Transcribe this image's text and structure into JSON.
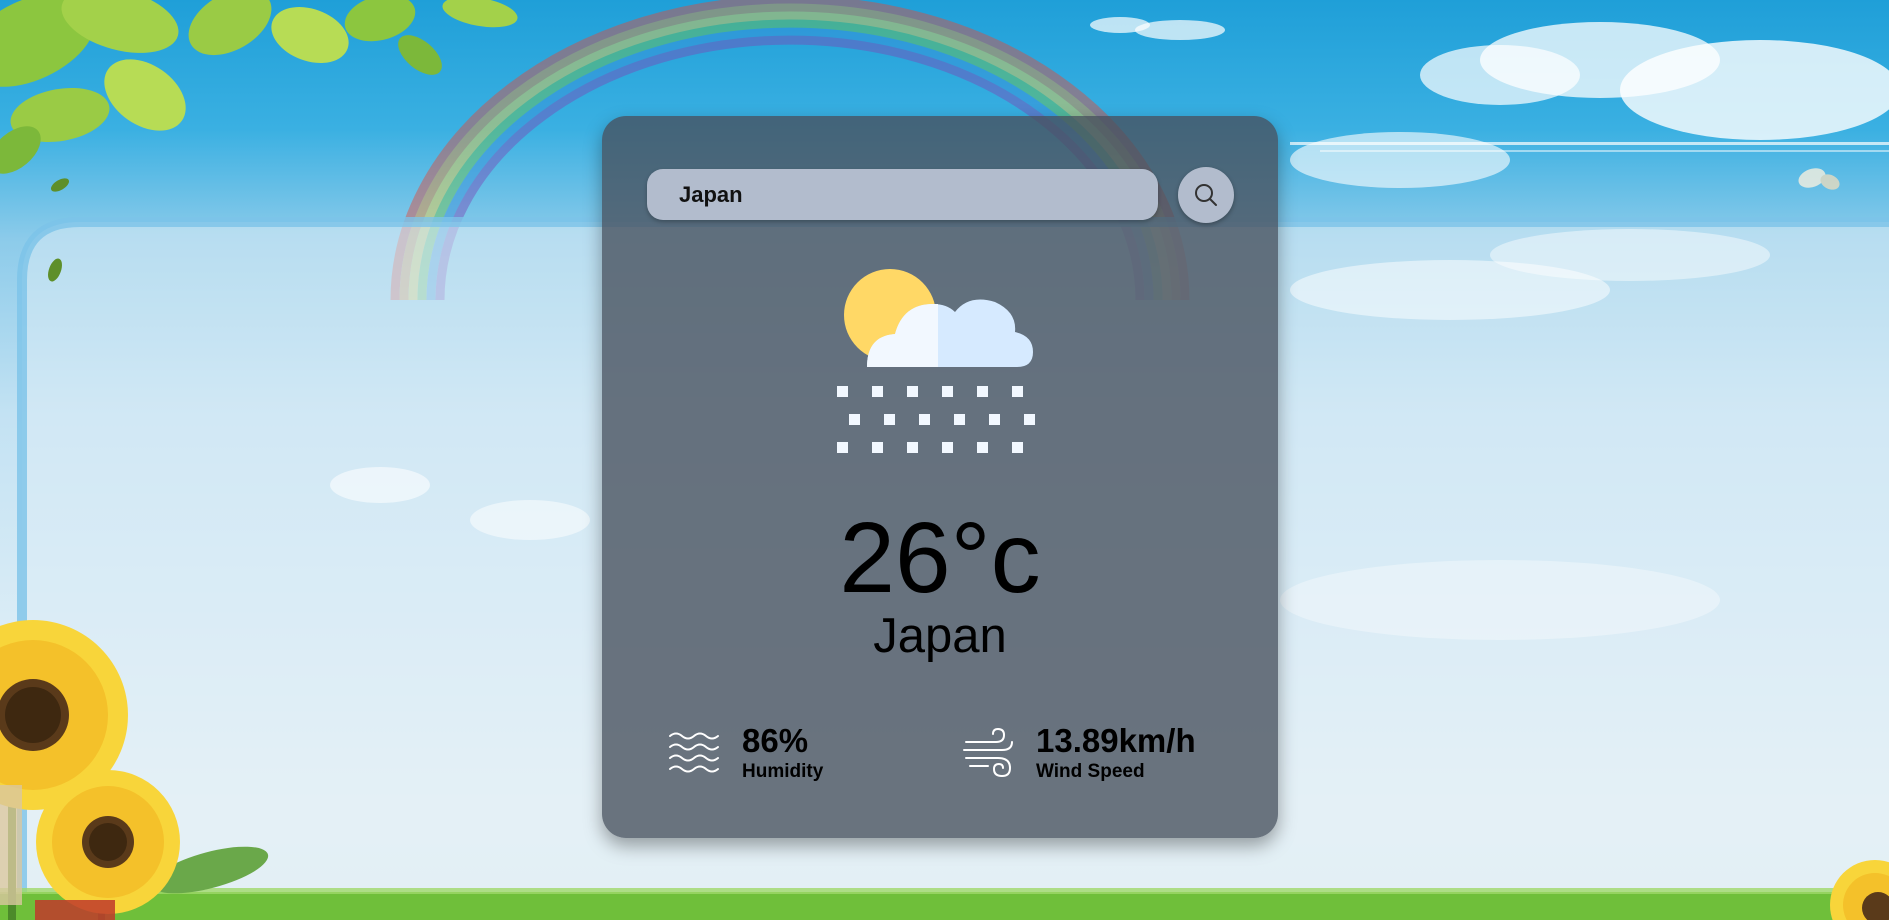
{
  "search": {
    "value": "Japan",
    "button_icon": "search-icon"
  },
  "weather": {
    "icon": "cloud-sun-snow-icon",
    "temperature": "26°c",
    "city": "Japan"
  },
  "details": {
    "humidity": {
      "value": "86%",
      "label": "Humidity",
      "icon": "humidity-waves-icon"
    },
    "wind": {
      "value": "13.89km/h",
      "label": "Wind Speed",
      "icon": "wind-icon"
    }
  },
  "colors": {
    "sky_top": "#1f9fd8",
    "card_bg": "#46505c",
    "input_bg": "#b2bccd",
    "sun": "#ffd866",
    "cloud_light": "#f2f8ff",
    "cloud_shade": "#d6eaff",
    "grass": "#6fbf3a"
  }
}
